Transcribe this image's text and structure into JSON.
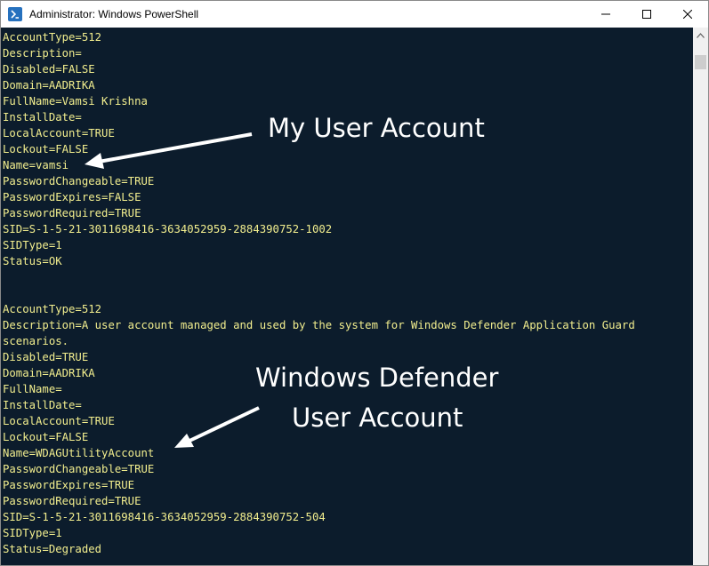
{
  "window": {
    "title": "Administrator: Windows PowerShell",
    "icon": "powershell-icon",
    "controls": [
      "minimize-icon",
      "maximize-icon",
      "close-icon"
    ],
    "console_background": "#0c1c2c",
    "console_text_color": "#f2ee8e"
  },
  "console": {
    "lines": [
      "AccountType=512",
      "Description=",
      "Disabled=FALSE",
      "Domain=AADRIKA",
      "FullName=Vamsi Krishna",
      "InstallDate=",
      "LocalAccount=TRUE",
      "Lockout=FALSE",
      "Name=vamsi",
      "PasswordChangeable=TRUE",
      "PasswordExpires=FALSE",
      "PasswordRequired=TRUE",
      "SID=S-1-5-21-3011698416-3634052959-2884390752-1002",
      "SIDType=1",
      "Status=OK",
      "",
      "",
      "AccountType=512",
      "Description=A user account managed and used by the system for Windows Defender Application Guard",
      "scenarios.",
      "Disabled=TRUE",
      "Domain=AADRIKA",
      "FullName=",
      "InstallDate=",
      "LocalAccount=TRUE",
      "Lockout=FALSE",
      "Name=WDAGUtilityAccount",
      "PasswordChangeable=TRUE",
      "PasswordExpires=TRUE",
      "PasswordRequired=TRUE",
      "SID=S-1-5-21-3011698416-3634052959-2884390752-504",
      "SIDType=1",
      "Status=Degraded"
    ]
  },
  "annotations": {
    "my_account": "My User Account",
    "defender_account_line1": "Windows Defender",
    "defender_account_line2": "User Account"
  }
}
